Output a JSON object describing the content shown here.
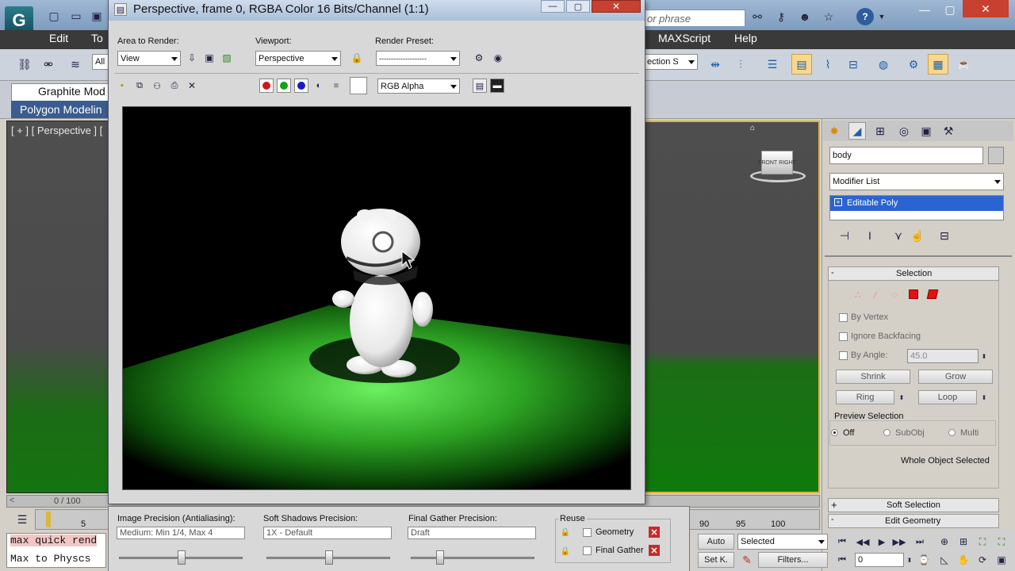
{
  "app": {
    "search_placeholder": "or phrase",
    "menu": {
      "edit": "Edit",
      "tools_partial": "To",
      "maxscript": "MAXScript",
      "help": "Help"
    },
    "ribbon": {
      "graphite_tab": "Graphite Mod",
      "polygon_modeling": "Polygon Modelin"
    },
    "toolbar": {
      "selection_filter": "All",
      "named_selection_partial": "ection S"
    },
    "viewport": {
      "label": "[ + ] [ Perspective ] [",
      "viewcube_front": "FRONT",
      "viewcube_right": "RIGHT"
    },
    "timeline": {
      "frame_counter": "0 / 100",
      "ticks_left": [
        "5"
      ],
      "ticks_right": [
        "90",
        "95",
        "100"
      ]
    },
    "maxscript_listener": [
      "max quick rend",
      "Max to Physcs"
    ],
    "anim_controls": {
      "auto_key": "Auto",
      "set_key": "Set K.",
      "key_filter": "Selected",
      "filters": "Filters...",
      "current_frame": "0"
    }
  },
  "command_panel": {
    "object_name": "body",
    "object_color": "#c8c8c8",
    "modifier_list": "Modifier List",
    "stack_item": "Editable Poly",
    "selection_rollout": {
      "title": "Selection",
      "by_vertex": "By Vertex",
      "ignore_backfacing": "Ignore Backfacing",
      "by_angle": "By Angle:",
      "angle_value": "45.0",
      "shrink": "Shrink",
      "grow": "Grow",
      "ring": "Ring",
      "loop": "Loop",
      "preview_selection": "Preview Selection",
      "preview_options": [
        "Off",
        "SubObj",
        "Multi"
      ],
      "status": "Whole Object Selected"
    },
    "soft_selection": "Soft Selection",
    "edit_geometry": "Edit Geometry"
  },
  "render_window": {
    "title": "Perspective, frame 0, RGBA Color 16 Bits/Channel (1:1)",
    "area_to_render_label": "Area to Render:",
    "area_to_render_value": "View",
    "viewport_label": "Viewport:",
    "viewport_value": "Perspective",
    "render_preset_label": "Render Preset:",
    "render_preset_value": "--------------------",
    "channel_value": "RGB Alpha",
    "channel_colors": {
      "red": "#d01818",
      "green": "#13a313",
      "blue": "#1a1acc"
    },
    "image_precision_label": "Image Precision (Antialiasing):",
    "image_precision_value": "Medium: Min 1/4, Max 4",
    "soft_shadows_label": "Soft Shadows Precision:",
    "soft_shadows_value": "1X - Default",
    "final_gather_label": "Final Gather Precision:",
    "final_gather_value": "Draft",
    "reuse_label": "Reuse",
    "reuse_geometry": "Geometry",
    "reuse_final_gather": "Final Gather"
  }
}
